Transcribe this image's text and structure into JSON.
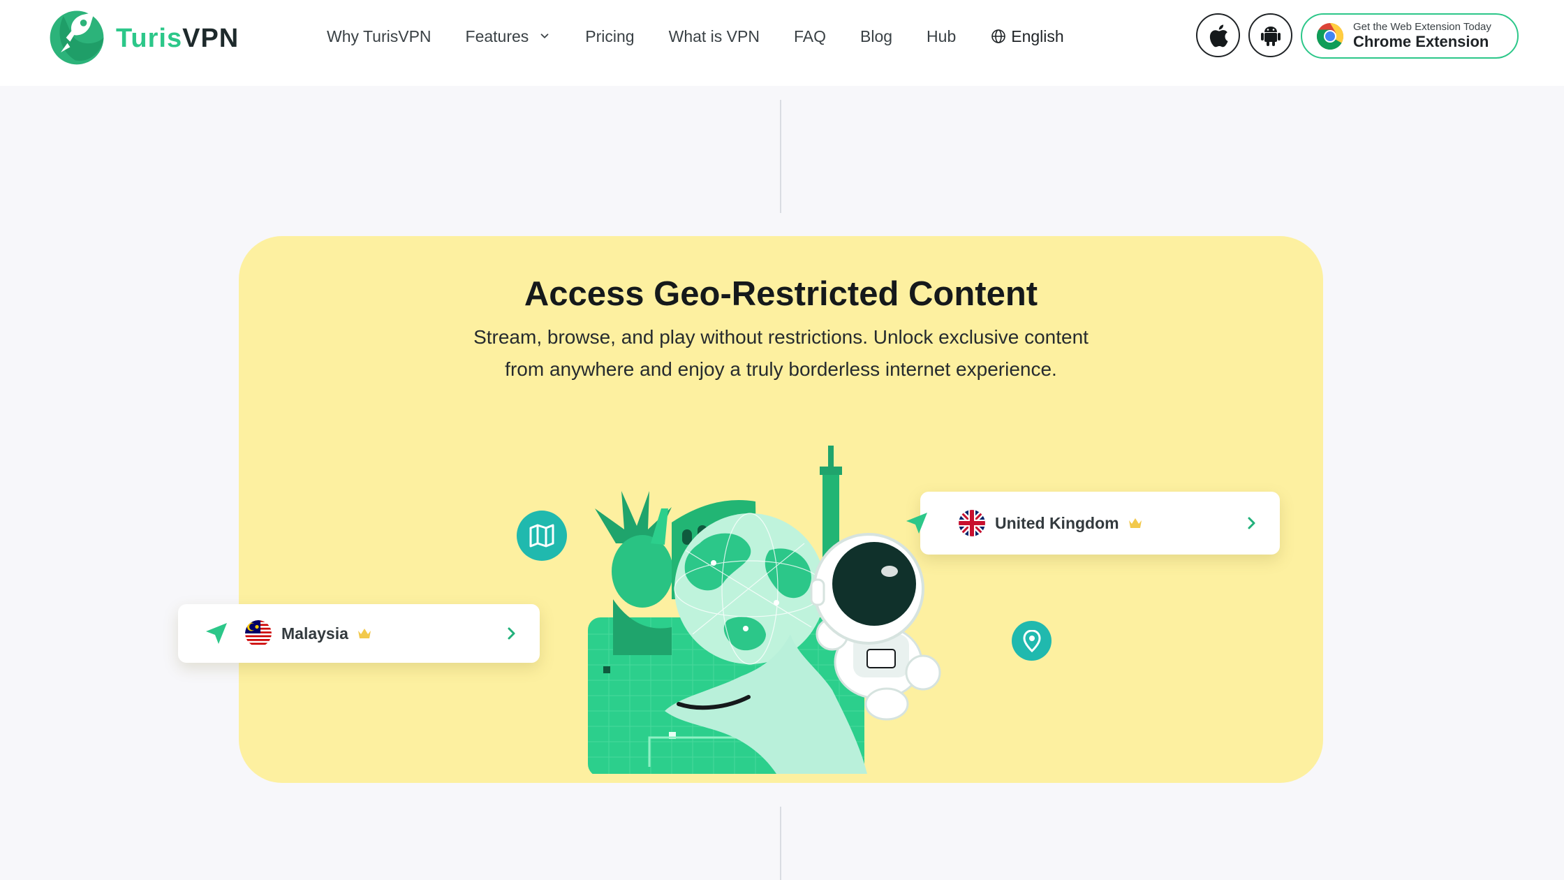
{
  "brand": {
    "name_part1": "Turis",
    "name_part2": "VPN",
    "accent": "#2cc789"
  },
  "nav": {
    "items": [
      {
        "label": "Why TurisVPN"
      },
      {
        "label": "Features",
        "has_dropdown": true
      },
      {
        "label": "Pricing"
      },
      {
        "label": "What is VPN"
      },
      {
        "label": "FAQ"
      },
      {
        "label": "Blog"
      },
      {
        "label": "Hub"
      }
    ],
    "language": "English"
  },
  "downloads": {
    "apple_icon": "apple-icon",
    "android_icon": "android-icon",
    "chrome": {
      "small": "Get the Web Extension Today",
      "big": "Chrome Extension",
      "icon": "chrome-icon"
    }
  },
  "feature": {
    "title": "Access Geo-Restricted Content",
    "description": "Stream, browse, and play without restrictions. Unlock exclusive content from anywhere and enjoy a truly borderless internet experience.",
    "card_color": "#fdf0a0",
    "locations": [
      {
        "country": "Malaysia",
        "flag_icon": "malaysia-flag-icon",
        "premium_icon": "crown-icon"
      },
      {
        "country": "United Kingdom",
        "flag_icon": "uk-flag-icon",
        "premium_icon": "crown-icon"
      }
    ],
    "badges": [
      "map-icon",
      "location-pin-icon"
    ]
  }
}
